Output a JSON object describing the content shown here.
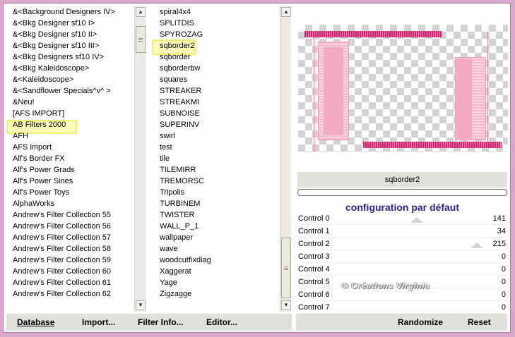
{
  "categories": [
    "&<Background Designers IV>",
    "&<Bkg Designer sf10 I>",
    "&<Bkg Designer sf10 II>",
    "&<Bkg Designer sf10 III>",
    "&<Bkg Designers sf10 IV>",
    "&<Bkg Kaleidoscope>",
    "&<Kaleidoscope>",
    "&<Sandflower Specials^v^ >",
    "&Neu!",
    "[AFS IMPORT]",
    "AB Filters 2000",
    "AFH",
    "AFS import",
    "Alf's Border FX",
    "Alf's Power Grads",
    "Alf's Power Sines",
    "Alf's Power Toys",
    "AlphaWorks",
    "Andrew's Filter Collection 55",
    "Andrew's Filter Collection 56",
    "Andrew's Filter Collection 57",
    "Andrew's Filter Collection 58",
    "Andrew's Filter Collection 59",
    "Andrew's Filter Collection 60",
    "Andrew's Filter Collection 61",
    "Andrew's Filter Collection 62"
  ],
  "selected_category": "[AFS IMPORT]",
  "filters": [
    "spiral4x4",
    "SPLITDIS",
    "SPYROZAG",
    "sqborder2",
    "sqborder",
    "sqborderbw",
    "squares",
    "STREAKER",
    "STREAKMI",
    "SUBNOISE",
    "SUPERINV",
    "swirl",
    "test",
    "tile",
    "TILEMIRR",
    "TREMORSC",
    "Tripolis",
    "TURBINEM",
    "TWISTER",
    "WALL_P_1",
    "wallpaper",
    "wave",
    "woodcutfixdiag",
    "Xaggerat",
    "Yage",
    "Zigzagge"
  ],
  "selected_filter": "sqborder2",
  "effect_name": "sqborder2",
  "config_title": "configuration par défaut",
  "controls": [
    {
      "label": "Control 0",
      "value": "141"
    },
    {
      "label": "Control 1",
      "value": "34"
    },
    {
      "label": "Control 2",
      "value": "215"
    },
    {
      "label": "Control 3",
      "value": "0"
    },
    {
      "label": "Control 4",
      "value": "0"
    },
    {
      "label": "Control 5",
      "value": "0"
    },
    {
      "label": "Control 6",
      "value": "0"
    },
    {
      "label": "Control 7",
      "value": "0"
    }
  ],
  "watermark": "© Créations Virginia",
  "bottom_left": {
    "database": "Database",
    "import": "Import...",
    "filter_info": "Filter Info...",
    "editor": "Editor..."
  },
  "bottom_right": {
    "randomize": "Randomize",
    "reset": "Reset"
  },
  "colors": {
    "highlight_border": "#f0f06a",
    "config_title": "#2f1e89",
    "preview_pink": "#d4236a",
    "window_background": "#d9a9cc"
  }
}
